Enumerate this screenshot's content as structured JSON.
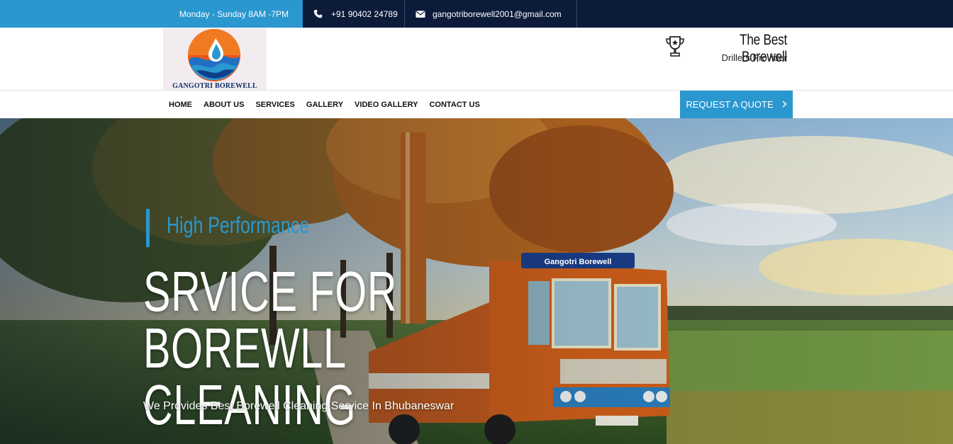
{
  "topbar": {
    "hours": "Monday - Sunday  8AM -7PM",
    "phone": "+91 90402 24789",
    "email": "gangotriborewell2001@gmail.com",
    "icons": {
      "phone": "phone-icon",
      "email": "envelope-icon"
    }
  },
  "header": {
    "logo_text": "GANGOTRI BOREWELL",
    "tagline_main": "The Best Borewell",
    "tagline_sub": "Drillers Provider",
    "award_icon": "trophy-icon"
  },
  "nav": {
    "items": [
      "HOME",
      "ABOUT US",
      "SERVICES",
      "GALLERY",
      "VIDEO GALLERY",
      "CONTACT US"
    ],
    "quote_label": "REQUEST A QUOTE",
    "quote_icon": "chevron-right-icon"
  },
  "hero": {
    "kicker": "High Performance",
    "title_line1": "SRVICE FOR BOREWLL",
    "title_line2": "CLEANING",
    "subtitle": "We Provides Best Borewell Cleaning Service In Bhubaneswar",
    "truck_label": "Gangotri Borewell"
  },
  "colors": {
    "accent": "#2a97cf",
    "topbar_dark": "#0c1b3a",
    "logo_navy": "#0f2f6b"
  }
}
